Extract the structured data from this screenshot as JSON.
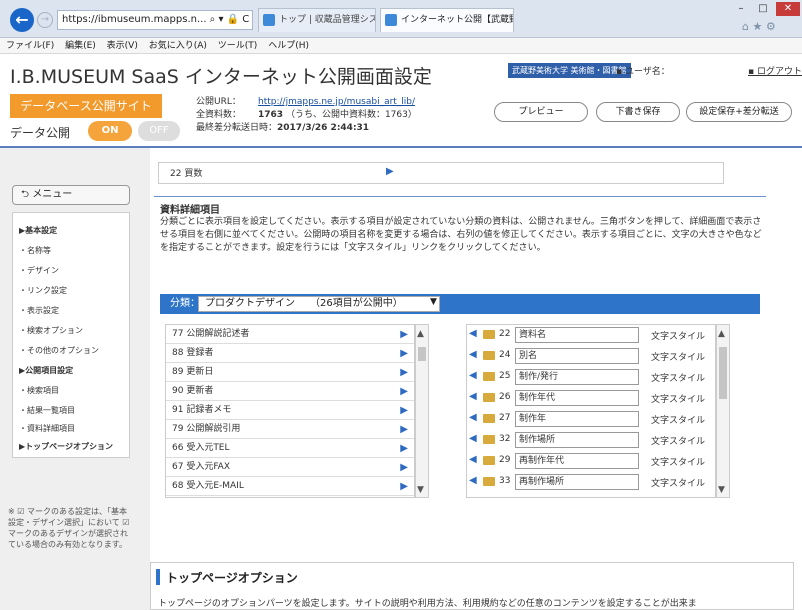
{
  "browser": {
    "address": "https://ibmuseum.mapps.n... ⌕ ▾ 🔒 C",
    "tabs": [
      {
        "label": "トップ | 収蔵品管理システム I.B...."
      },
      {
        "label": "インターネット公開【武蔵野美... ×"
      }
    ],
    "window_buttons": {
      "min": "–",
      "max": "□",
      "close": "✕"
    },
    "chrome_icons": "⌂ ★ ⚙",
    "back": "←",
    "forward": "→",
    "menu": [
      "ファイル(F)",
      "編集(E)",
      "表示(V)",
      "お気に入り(A)",
      "ツール(T)",
      "ヘルプ(H)"
    ]
  },
  "header": {
    "title": "I.B.MUSEUM SaaS インターネット公開画面設定",
    "univ": "武蔵野美術大学 美術館・図書館",
    "user_label": "▪ ユーザ名：",
    "logout": "▪ ログアウト",
    "db_site": "データベース公開サイト",
    "publish_label": "データ公開",
    "on": "ON",
    "off": "OFF",
    "url_label": "公開URL：",
    "url": "http://jmapps.ne.jp/musabi_art_lib/",
    "count_label": "全資料数：",
    "count_value": "1763",
    "count_note": "（うち、公開中資料数：1763）",
    "last_label": "最終差分転送日時：",
    "last_value": "2017/3/26 2:44:31",
    "preview": "プレビュー",
    "draft": "下書き保存",
    "save_send": "設定保存+差分転送"
  },
  "sidebar": {
    "menu_button": "⮌ メニュー",
    "items": [
      {
        "label": "▶基本設定",
        "head": true
      },
      {
        "label": "・名称等",
        "head": false
      },
      {
        "label": "・デザイン",
        "head": false
      },
      {
        "label": "・リンク設定",
        "head": false
      },
      {
        "label": "・表示設定",
        "head": false
      },
      {
        "label": "・検索オプション",
        "head": false
      },
      {
        "label": "・その他のオプション",
        "head": false
      },
      {
        "label": "▶公開項目設定",
        "head": true
      },
      {
        "label": "・検索項目",
        "head": false
      },
      {
        "label": "・結果一覧項目",
        "head": false
      },
      {
        "label": "・資料詳細項目",
        "head": false
      },
      {
        "label": "▶トップページオプション",
        "head": true
      }
    ],
    "note": "※ ☑ マークのある設定は、「基本設定・デザイン選択」において ☑ マークのあるデザインが選択されている場合のみ有効となります。"
  },
  "main": {
    "prev_row": "22 買数",
    "section_title": "資料詳細項目",
    "description": "分類ごとに表示項目を設定してください。表示する項目が設定されていない分類の資料は、公開されません。三角ボタンを押して、詳細画面で表示させる項目を右側に並べてください。公開時の項目名称を変更する場合は、右列の値を修正してください。表示する項目ごとに、文字の大きさや色などを指定することができます。設定を行うには「文字スタイル」リンクをクリックしてください。",
    "category_label": "分類：",
    "category_value": "プロダクトデザイン　　（26項目が公開中）",
    "left_items": [
      "77 公開解説記述者",
      "88 登録者",
      "89 更新日",
      "90 更新者",
      "91 記録者メモ",
      "79 公開解説引用",
      "66 受入元TEL",
      "67 受入元FAX",
      "68 受入元E-MAIL"
    ],
    "right_items": [
      {
        "num": "22",
        "name": "資料名"
      },
      {
        "num": "24",
        "name": "別名"
      },
      {
        "num": "25",
        "name": "制作/発行"
      },
      {
        "num": "26",
        "name": "制作年代"
      },
      {
        "num": "27",
        "name": "制作年"
      },
      {
        "num": "32",
        "name": "制作場所"
      },
      {
        "num": "29",
        "name": "再制作年代"
      },
      {
        "num": "33",
        "name": "再制作場所"
      }
    ],
    "style_link": "文字スタイル",
    "top_option_title": "トップページオプション",
    "top_option_desc": "トップページのオプションパーツを設定します。サイトの説明や利用方法、利用規約などの任意のコンテンツを設定することが出来ま"
  },
  "colors": {
    "accent": "#2e75c9",
    "orange": "#f39a2c"
  }
}
